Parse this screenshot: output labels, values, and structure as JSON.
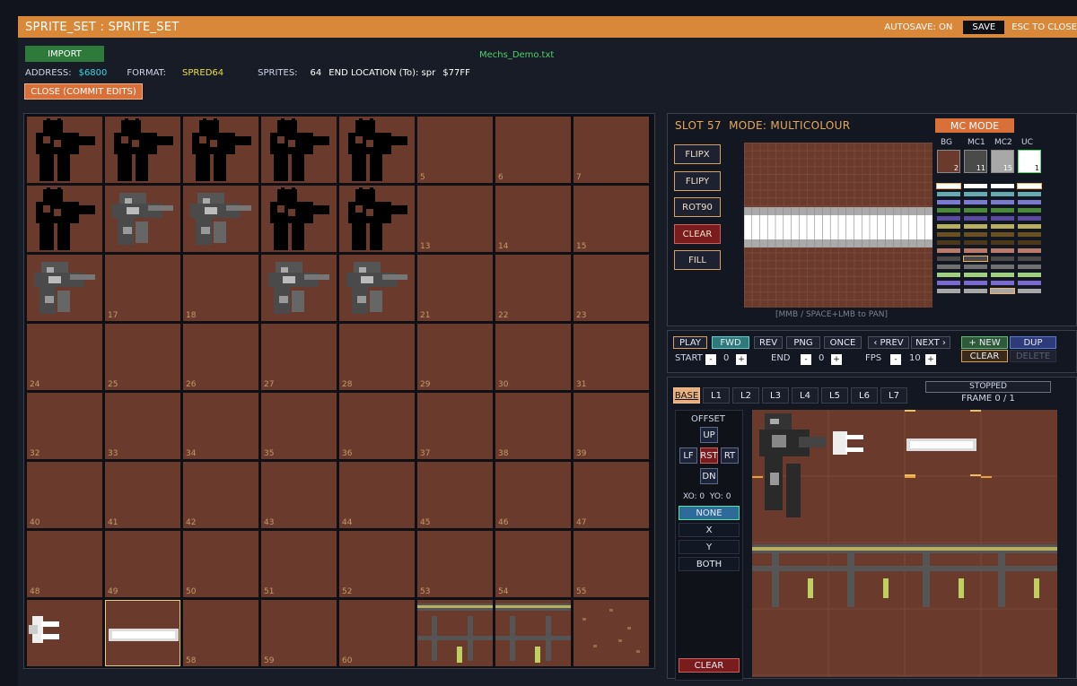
{
  "title": "SPRITE_SET : SPRITE_SET",
  "autosave": "AUTOSAVE: ON",
  "save": "SAVE",
  "esc": "ESC TO CLOSE",
  "import": "IMPORT",
  "filename": "Mechs_Demo.txt",
  "info": {
    "address_label": "ADDRESS:",
    "address": "$6800",
    "format_label": "FORMAT:",
    "format": "SPRED64",
    "sprites_label": "SPRITES:",
    "sprites": "64",
    "end_label": "END LOCATION (To): spr",
    "end": "$77FF"
  },
  "close_commit": "CLOSE (COMMIT EDITS)",
  "sheet": {
    "numbers": [
      "",
      "",
      "",
      "",
      "",
      "5",
      "6",
      "7",
      "",
      "",
      "",
      "",
      "",
      "13",
      "14",
      "15",
      "",
      "17",
      "18",
      "",
      "",
      "21",
      "22",
      "23",
      "24",
      "25",
      "26",
      "27",
      "28",
      "29",
      "30",
      "31",
      "32",
      "33",
      "34",
      "35",
      "36",
      "37",
      "38",
      "39",
      "40",
      "41",
      "42",
      "43",
      "44",
      "45",
      "46",
      "47",
      "48",
      "49",
      "50",
      "51",
      "52",
      "53",
      "54",
      "55",
      "",
      "",
      "58",
      "59",
      "60",
      "",
      "",
      ""
    ],
    "selected": 57
  },
  "editor": {
    "slot": "SLOT 57",
    "mode": "MODE: MULTICOLOUR",
    "mc_mode": "MC MODE",
    "tools": [
      "FLIPX",
      "FLIPY",
      "ROT90",
      "CLEAR",
      "FILL"
    ],
    "pan_hint": "[MMB / SPACE+LMB to PAN]",
    "swatches": [
      {
        "label": "BG",
        "value": "2",
        "color": "#6a3a2c"
      },
      {
        "label": "MC1",
        "value": "11",
        "color": "#4a4a4a"
      },
      {
        "label": "MC2",
        "value": "15",
        "color": "#a8a8a8"
      },
      {
        "label": "UC",
        "value": "1",
        "color": "#ffffff"
      }
    ]
  },
  "anim": {
    "play": "PLAY",
    "fwd": "FWD",
    "rev": "REV",
    "png": "PNG",
    "once": "ONCE",
    "prev": "‹ PREV",
    "next": "NEXT ›",
    "new": "+ NEW",
    "dup": "DUP",
    "clear": "CLEAR",
    "delete": "DELETE",
    "start_label": "START",
    "start": "0",
    "end_label": "END",
    "end": "0",
    "fps_label": "FPS",
    "fps": "10",
    "minus": "-",
    "plus": "+"
  },
  "layers": {
    "tabs": [
      "BASE",
      "L1",
      "L2",
      "L3",
      "L4",
      "L5",
      "L6",
      "L7"
    ],
    "status": "STOPPED",
    "frame": "FRAME 0 / 1"
  },
  "offset": {
    "title": "OFFSET",
    "up": "UP",
    "lf": "LF",
    "rst": "RST",
    "rt": "RT",
    "dn": "DN",
    "xo": "XO: 0",
    "yo": "YO: 0",
    "modes": [
      "NONE",
      "X",
      "Y",
      "BOTH"
    ],
    "clear": "CLEAR"
  },
  "palette": [
    "#ffffff",
    "#68a8b0",
    "#7a7acf",
    "#4a8a3a",
    "#5a4aa0",
    "#b8b060",
    "#6a5020",
    "#4a3818",
    "#b87a6a",
    "#4a4a4a",
    "#707070",
    "#a0d080",
    "#7a6ad0",
    "#a8a8a8"
  ]
}
